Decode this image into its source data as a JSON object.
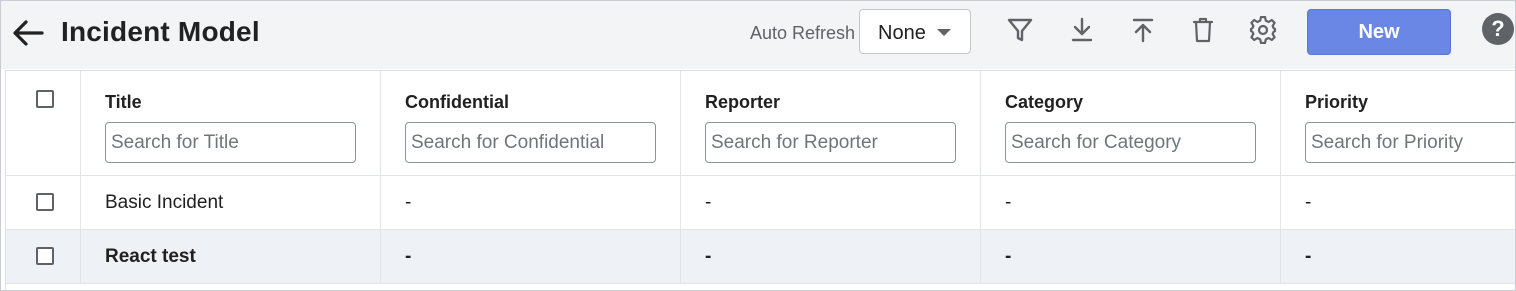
{
  "header": {
    "title": "Incident Model",
    "auto_refresh_label": "Auto Refresh",
    "auto_refresh_value": "None",
    "new_button_label": "New",
    "help_label": "?",
    "icons": [
      "back-arrow-icon",
      "filter-icon",
      "download-icon",
      "upload-icon",
      "delete-icon",
      "settings-icon",
      "help-icon"
    ]
  },
  "table": {
    "columns": [
      {
        "title": "Title",
        "placeholder": "Search for Title"
      },
      {
        "title": "Confidential",
        "placeholder": "Search for Confidential"
      },
      {
        "title": "Reporter",
        "placeholder": "Search for Reporter"
      },
      {
        "title": "Category",
        "placeholder": "Search for Category"
      },
      {
        "title": "Priority",
        "placeholder": "Search for Priority"
      }
    ],
    "rows": [
      {
        "cells": [
          "Basic Incident",
          "-",
          "-",
          "-",
          "-"
        ],
        "bold": false
      },
      {
        "cells": [
          "React test",
          "-",
          "-",
          "-",
          "-"
        ],
        "bold": true
      }
    ]
  },
  "colors": {
    "accent": "#6b87e6",
    "header_bg": "#f3f4f6",
    "alt_row_bg": "#eef1f6"
  }
}
